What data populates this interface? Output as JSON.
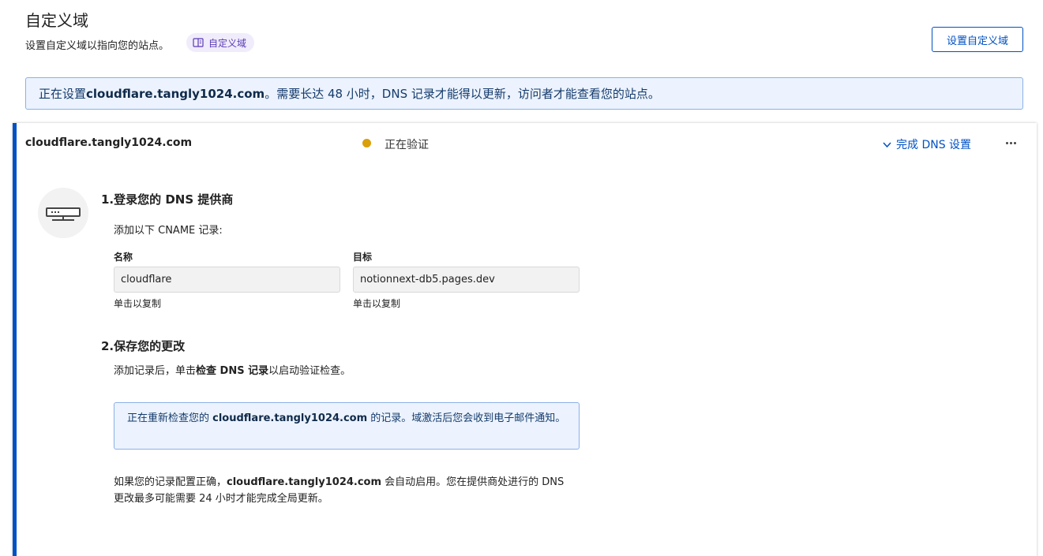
{
  "header": {
    "title": "自定义域",
    "subtitle": "设置自定义域以指向您的站点。",
    "doc_chip_label": "自定义域",
    "setup_button_label": "设置自定义域"
  },
  "banner": {
    "prefix": "正在设置 ",
    "domain": "cloudflare.tangly1024.com",
    "suffix": "。需要长达 48 小时，DNS 记录才能得以更新，访问者才能查看您的站点。"
  },
  "card": {
    "domain": "cloudflare.tangly1024.com",
    "status": "正在验证",
    "status_color": "#d9a009",
    "finish_link": "完成 DNS 设置",
    "step1": {
      "title": "1.登录您的 DNS 提供商",
      "desc": "添加以下 CNAME 记录:",
      "name_label": "名称",
      "name_value": "cloudflare",
      "name_hint": "单击以复制",
      "target_label": "目标",
      "target_value": "notionnext-db5.pages.dev",
      "target_hint": "单击以复制"
    },
    "step2": {
      "title": "2.保存您的更改",
      "desc_prefix": "添加记录后，单击",
      "desc_bold": "检查 DNS 记录",
      "desc_suffix": "以启动验证检查。"
    },
    "info": {
      "prefix": "正在重新检查您的 ",
      "domain": "cloudflare.tangly1024.com",
      "suffix": " 的记录。域激活后您会收到电子邮件通知。"
    },
    "note": {
      "prefix": "如果您的记录配置正确，",
      "domain": "cloudflare.tangly1024.com",
      "suffix": " 会自动启用。您在提供商处进行的 DNS 更改最多可能需要 24 小时才能完成全局更新。"
    }
  },
  "colors": {
    "accent": "#0051c3",
    "info_bg": "#ecf3fe",
    "chip_bg": "#f0ecfb"
  },
  "icons": [
    "book-icon",
    "chevron-down-icon",
    "more-icon",
    "server-icon"
  ]
}
